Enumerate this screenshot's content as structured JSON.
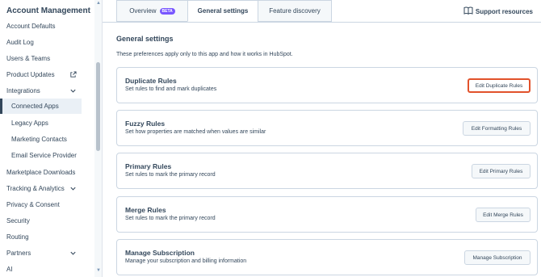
{
  "sidebar": {
    "title": "Account Management",
    "items": [
      {
        "label": "Account Defaults"
      },
      {
        "label": "Audit Log"
      },
      {
        "label": "Users & Teams"
      },
      {
        "label": "Product Updates"
      },
      {
        "label": "Integrations"
      },
      {
        "label": "Connected Apps"
      },
      {
        "label": "Legacy Apps"
      },
      {
        "label": "Marketing Contacts"
      },
      {
        "label": "Email Service Provider"
      },
      {
        "label": "Marketplace Downloads"
      },
      {
        "label": "Tracking & Analytics"
      },
      {
        "label": "Privacy & Consent"
      },
      {
        "label": "Security"
      },
      {
        "label": "Routing"
      },
      {
        "label": "Partners"
      },
      {
        "label": "AI"
      }
    ]
  },
  "tabs": [
    {
      "label": "Overview",
      "badge": "BETA"
    },
    {
      "label": "General settings"
    },
    {
      "label": "Feature discovery"
    }
  ],
  "support": {
    "label": "Support resources"
  },
  "main": {
    "title": "General settings",
    "description": "These preferences apply only to this app and how it works in HubSpot."
  },
  "cards": [
    {
      "title": "Duplicate Rules",
      "description": "Set rules to find and mark duplicates",
      "button": "Edit Duplicate Rules"
    },
    {
      "title": "Fuzzy Rules",
      "description": "Set how properties are matched when values are similar",
      "button": "Edit Formatting Rules"
    },
    {
      "title": "Primary Rules",
      "description": "Set rules to mark the primary record",
      "button": "Edit Primary Rules"
    },
    {
      "title": "Merge Rules",
      "description": "Set rules to mark the primary record",
      "button": "Edit Merge Rules"
    },
    {
      "title": "Manage Subscription",
      "description": "Manage your subscription and billing information",
      "button": "Manage Subscription"
    }
  ],
  "colors": {
    "highlight": "#e2522b",
    "beta_badge": "#7856ff",
    "text": "#33475b"
  }
}
